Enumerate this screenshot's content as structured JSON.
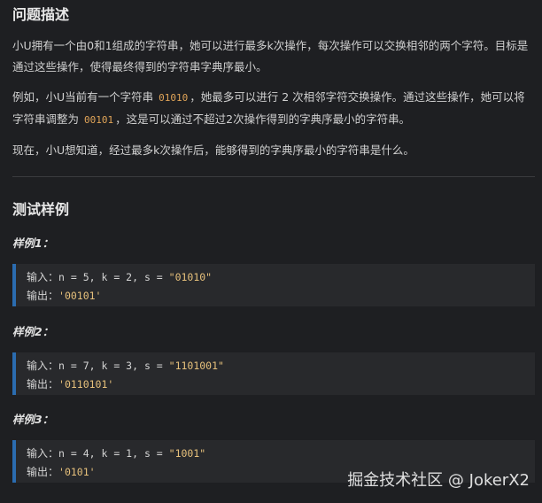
{
  "section1": {
    "title": "问题描述",
    "p1": "小U拥有一个由0和1组成的字符串，她可以进行最多k次操作，每次操作可以交换相邻的两个字符。目标是通过这些操作，使得最终得到的字符串字典序最小。",
    "p2_before": "例如，小U当前有一个字符串 ",
    "p2_code1": "01010",
    "p2_middle": "，她最多可以进行 2 次相邻字符交换操作。通过这些操作，她可以将字符串调整为 ",
    "p2_code2": "00101",
    "p2_after": "，这是可以通过不超过2次操作得到的字典序最小的字符串。",
    "p3": "现在，小U想知道，经过最多k次操作后，能够得到的字典序最小的字符串是什么。"
  },
  "section2": {
    "title": "测试样例",
    "examples": [
      {
        "label": "样例1：",
        "input_key": "输入：",
        "input_val": "n = 5, k = 2, s = ",
        "input_str": "\"01010\"",
        "output_key": "输出：",
        "output_val": "'00101'"
      },
      {
        "label": "样例2：",
        "input_key": "输入：",
        "input_val": "n = 7, k = 3, s = ",
        "input_str": "\"1101001\"",
        "output_key": "输出：",
        "output_val": "'0110101'"
      },
      {
        "label": "样例3：",
        "input_key": "输入：",
        "input_val": "n = 4, k = 1, s = ",
        "input_str": "\"1001\"",
        "output_key": "输出：",
        "output_val": "'0101'"
      }
    ]
  },
  "watermark": "掘金技术社区 @ JokerX2"
}
